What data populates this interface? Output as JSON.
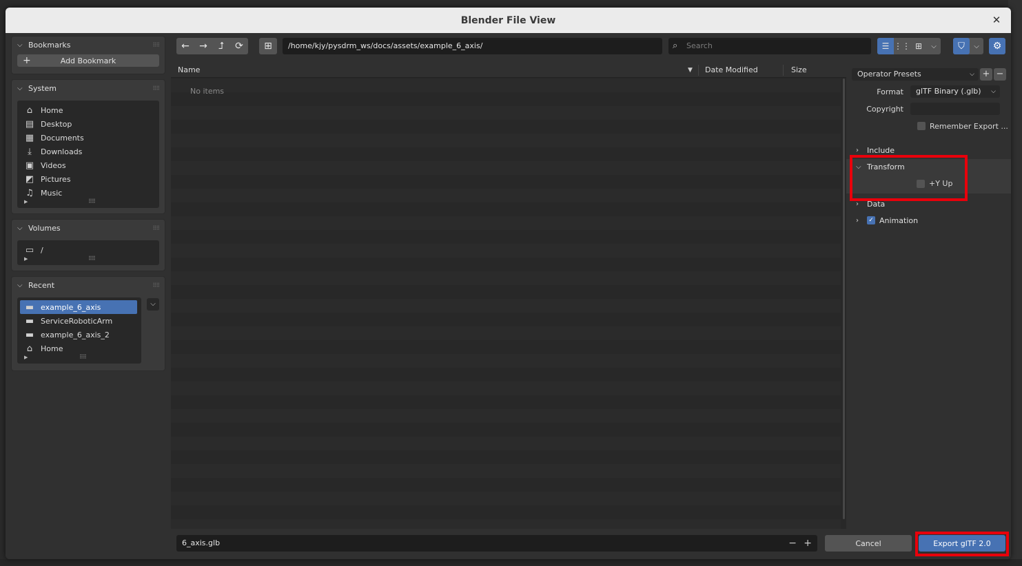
{
  "window": {
    "title": "Blender File View"
  },
  "bookmarks": {
    "header": "Bookmarks",
    "add_label": "Add Bookmark"
  },
  "system": {
    "header": "System",
    "items": [
      {
        "label": "Home",
        "icon": "home-icon"
      },
      {
        "label": "Desktop",
        "icon": "desktop-icon"
      },
      {
        "label": "Documents",
        "icon": "documents-icon"
      },
      {
        "label": "Downloads",
        "icon": "downloads-icon"
      },
      {
        "label": "Videos",
        "icon": "videos-icon"
      },
      {
        "label": "Pictures",
        "icon": "pictures-icon"
      },
      {
        "label": "Music",
        "icon": "music-icon"
      }
    ]
  },
  "volumes": {
    "header": "Volumes",
    "items": [
      {
        "label": "/"
      }
    ]
  },
  "recent": {
    "header": "Recent",
    "items": [
      {
        "label": "example_6_axis",
        "selected": true
      },
      {
        "label": "ServiceRoboticArm"
      },
      {
        "label": "example_6_axis_2"
      },
      {
        "label": "Home"
      }
    ]
  },
  "toolbar": {
    "path": "/home/kjy/pysdrm_ws/docs/assets/example_6_axis/",
    "search_placeholder": "Search"
  },
  "file_list": {
    "columns": {
      "name": "Name",
      "date": "Date Modified",
      "size": "Size"
    },
    "empty_text": "No items"
  },
  "options": {
    "operator_presets": "Operator Presets",
    "format_label": "Format",
    "format_value": "glTF Binary (.glb)",
    "copyright_label": "Copyright",
    "copyright_value": "",
    "remember_label": "Remember Export ...",
    "sections": {
      "include": "Include",
      "transform": "Transform",
      "y_up": "+Y Up",
      "data": "Data",
      "animation": "Animation"
    },
    "y_up_checked": false,
    "animation_checked": true,
    "remember_checked": false
  },
  "bottom": {
    "filename": "6_axis.glb",
    "cancel_label": "Cancel",
    "export_label": "Export glTF 2.0"
  },
  "colors": {
    "accent": "#4772b3",
    "highlight": "#e8000b"
  }
}
